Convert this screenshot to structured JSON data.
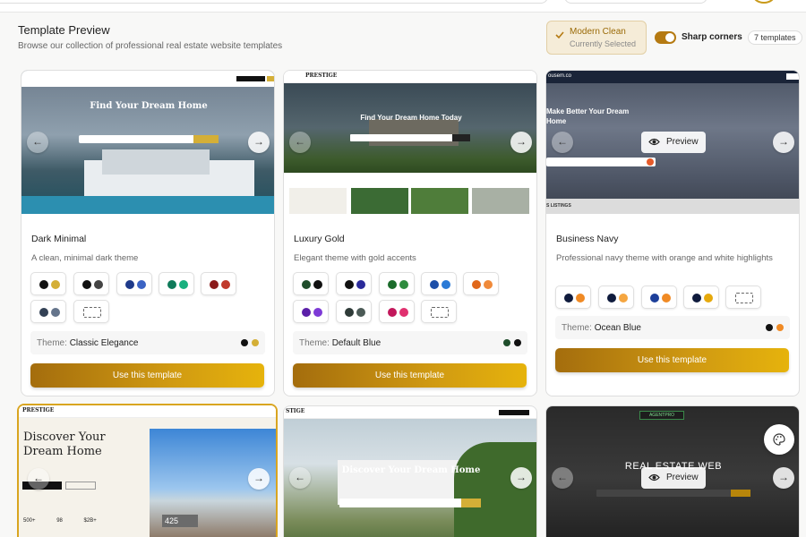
{
  "header": {
    "title": "Template Preview",
    "subtitle": "Browse our collection of professional real estate website templates"
  },
  "current_theme": {
    "name": "Modern Clean",
    "status": "Currently Selected"
  },
  "controls": {
    "sharp_corners_label": "Sharp corners",
    "sharp_corners_on": true,
    "template_count": "7 templates"
  },
  "buttons": {
    "use_template": "Use this template",
    "preview": "Preview"
  },
  "colors": {
    "accent": "#c99a1b",
    "button_start": "#a46d0d",
    "button_end": "#e6b30c"
  },
  "templates": [
    {
      "name": "Dark Minimal",
      "description": "A clean, minimal dark theme",
      "theme_label": "Theme:",
      "theme_value": "Classic Elegance",
      "hero_text": "Find Your Dream Home",
      "swatches": [
        [
          "#111111",
          "#d4af37"
        ],
        [
          "#111111",
          "#444444"
        ],
        [
          "#1e3a8a",
          "#3b63c4"
        ],
        [
          "#0f7a5a",
          "#18b07e"
        ],
        [
          "#8b1a1a",
          "#c0392b"
        ],
        [
          "#334155",
          "#64748b"
        ],
        [
          "dashed"
        ]
      ]
    },
    {
      "name": "Luxury Gold",
      "description": "Elegant theme with gold accents",
      "theme_label": "Theme:",
      "theme_value": "Default Blue",
      "hero_text": "Find Your Dream Home Today",
      "logo_text": "PRESTIGE",
      "swatches": [
        [
          "#1f4d2b",
          "#111111"
        ],
        [
          "#111111",
          "#2a2a9a"
        ],
        [
          "#1b6b2b",
          "#2e8b3e"
        ],
        [
          "#1d4fa8",
          "#2a7ad6"
        ],
        [
          "#e0671a",
          "#f08a3a"
        ],
        [
          "#5b1fa8",
          "#7d3ad6"
        ],
        [
          "#2f3b38",
          "#4b5a56"
        ],
        [
          "#c2185b",
          "#e0306f"
        ],
        [
          "dashed"
        ]
      ]
    },
    {
      "name": "Business Navy",
      "description": "Professional navy theme with orange and white highlights",
      "theme_label": "Theme:",
      "theme_value": "Ocean Blue",
      "hero_text": "Make Better Your Dream Home",
      "logo_text": "ousem.co",
      "listings_text": "S LISTINGS",
      "swatches": [
        [
          "#0f1b3d",
          "#f08a24"
        ],
        [
          "#0f1b3d",
          "#f5a640"
        ],
        [
          "#1d3f9a",
          "#f08a24"
        ],
        [
          "#0f1b3d",
          "#e6a90c"
        ],
        [
          "dashed"
        ]
      ]
    }
  ],
  "row2": [
    {
      "logo_text": "PRESTIGE",
      "hero_text": "Discover Your Dream Home",
      "stats": [
        "500+",
        "98",
        "$2B+"
      ],
      "badge": "425"
    },
    {
      "logo_text": "STIGE",
      "hero_text": "Discover Your Dream Home"
    },
    {
      "logo_text": "AGENTPRO",
      "hero_text": "REAL ESTATE WEB"
    }
  ]
}
